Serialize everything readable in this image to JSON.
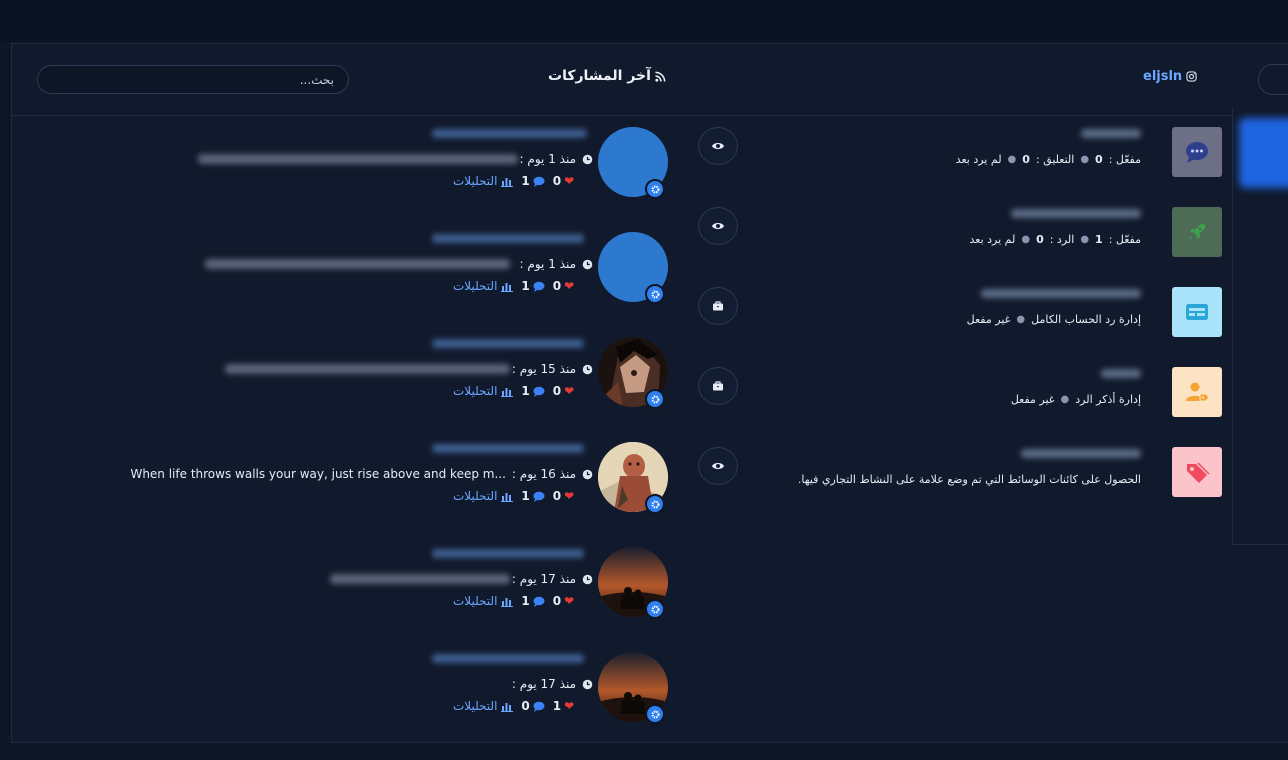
{
  "topbar": {
    "left_text": "",
    "right_text": ""
  },
  "header": {
    "search_placeholder": "بحث...",
    "title": "آخر المشاركات",
    "account_name": "eljsln"
  },
  "posts": [
    {
      "time": "منذ 1 يوم :",
      "caption": "",
      "likes": "0",
      "comments": "1",
      "analytics": "التحليلات",
      "avatar": "blue",
      "action": "eye-icon"
    },
    {
      "time": "منذ 1 يوم :",
      "caption": "",
      "likes": "0",
      "comments": "1",
      "analytics": "التحليلات",
      "avatar": "blue",
      "action": "eye-icon"
    },
    {
      "time": "منذ 15 يوم :",
      "caption": "",
      "likes": "0",
      "comments": "1",
      "analytics": "التحليلات",
      "avatar": "anime-character",
      "action": "briefcase-icon"
    },
    {
      "time": "منذ 16 يوم :",
      "caption": "When life throws walls your way, just rise above and keep m...",
      "likes": "0",
      "comments": "1",
      "analytics": "التحليلات",
      "avatar": "titan-character",
      "action": "briefcase-icon"
    },
    {
      "time": "منذ 17 يوم :",
      "caption": "",
      "likes": "0",
      "comments": "1",
      "analytics": "التحليلات",
      "avatar": "sunset-couple",
      "action": "eye-icon"
    },
    {
      "time": "منذ 17 يوم :",
      "caption": "",
      "likes": "1",
      "comments": "0",
      "analytics": "التحليلات",
      "avatar": "sunset-couple",
      "action": ""
    }
  ],
  "features": [
    {
      "icon": "chat-bubble-icon",
      "color": "#6c6f86",
      "desc_parts": [
        "مفعّل :",
        "0",
        "التعليق :",
        "0",
        "لم يرد بعد"
      ]
    },
    {
      "icon": "rocket-icon",
      "color": "#4e6c55",
      "desc_parts": [
        "مفعّل :",
        "1",
        "الرد :",
        "0",
        "لم يرد بعد"
      ]
    },
    {
      "icon": "card-icon",
      "color": "#a9e4fb",
      "desc_parts": [
        "إدارة رد الحساب الكامل",
        "غير مفعل"
      ]
    },
    {
      "icon": "user-tag-icon",
      "color": "#fde3c4",
      "desc_parts": [
        "إدارة أذكر الرد",
        "غير مفعل"
      ]
    },
    {
      "icon": "tag-icon",
      "color": "#fbc4cb",
      "desc_parts": [
        "الحصول على كائنات الوسائط التي تم وضع علامة على النشاط التجاري فيها."
      ]
    }
  ]
}
